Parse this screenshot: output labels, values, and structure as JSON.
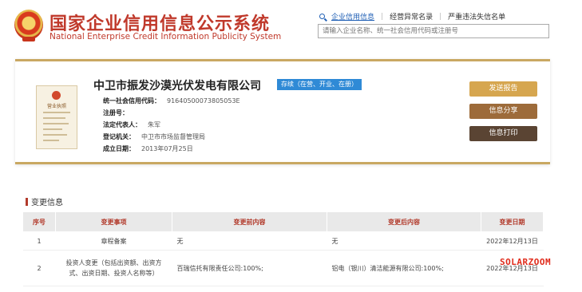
{
  "header": {
    "title": "国家企业信用信息公示系统",
    "subtitle": "National Enterprise Credit Information Publicity System",
    "nav": [
      {
        "label": "企业信用信息"
      },
      {
        "label": "经营异常名录"
      },
      {
        "label": "严重违法失信名单"
      }
    ],
    "search_placeholder": "请输入企业名称、统一社会信用代码或注册号"
  },
  "company": {
    "name": "中卫市振发沙漠光伏发电有限公司",
    "status": "存续（在营、开业、在册）",
    "license_title": "营业执照",
    "fields": [
      {
        "label": "统一社会信用代码：",
        "value": "91640500073805053E"
      },
      {
        "label": "注册号：",
        "value": ""
      },
      {
        "label": "法定代表人：",
        "value": "朱军"
      },
      {
        "label": "登记机关：",
        "value": "中卫市市场监督管理局"
      },
      {
        "label": "成立日期：",
        "value": "2013年07月25日"
      }
    ]
  },
  "actions": {
    "report": "发送报告",
    "share": "信息分享",
    "print": "信息打印"
  },
  "changes": {
    "title": "变更信息",
    "columns": [
      "序号",
      "变更事项",
      "变更前内容",
      "变更后内容",
      "变更日期"
    ],
    "rows": [
      {
        "no": "1",
        "item": "章程备案",
        "before": "无",
        "after": "无",
        "date": "2022年12月13日"
      },
      {
        "no": "2",
        "item": "投资人变更（包括出资额、出资方式、出资日期、投资人名称等）",
        "before": "百瑞信托有限责任公司:100%;",
        "after": "铝电（银川）清洁能源有限公司:100%;",
        "date": "2022年12月13日"
      }
    ]
  },
  "watermark": "SOLARZOOM",
  "colors": {
    "brand_red": "#c0392b",
    "gold": "#c9a862",
    "link_blue": "#1f5fb5",
    "status_blue": "#2f8ad6"
  }
}
